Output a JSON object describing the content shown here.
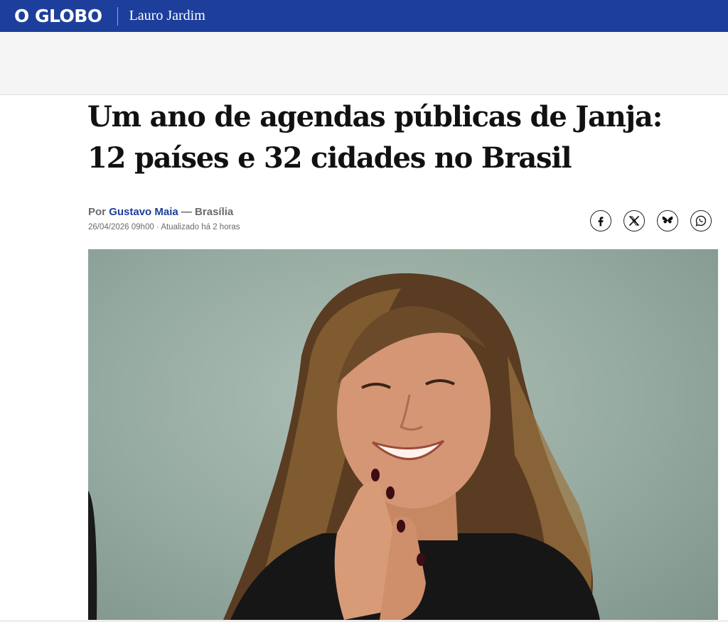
{
  "header": {
    "logo": "O GLOBO",
    "section": "Lauro Jardim",
    "brand_color": "#1d3f9b"
  },
  "article": {
    "headline": "Um ano de agendas públicas de Janja: 12 países e 32 cidades no Brasil",
    "byline_prefix": "Por",
    "author": "Gustavo Maia",
    "location": "— Brasília",
    "dateline": "26/04/2026 09h00 · Atualizado há 2 horas"
  },
  "share": {
    "icons": [
      "facebook-icon",
      "x-icon",
      "bluesky-icon",
      "whatsapp-icon"
    ]
  }
}
